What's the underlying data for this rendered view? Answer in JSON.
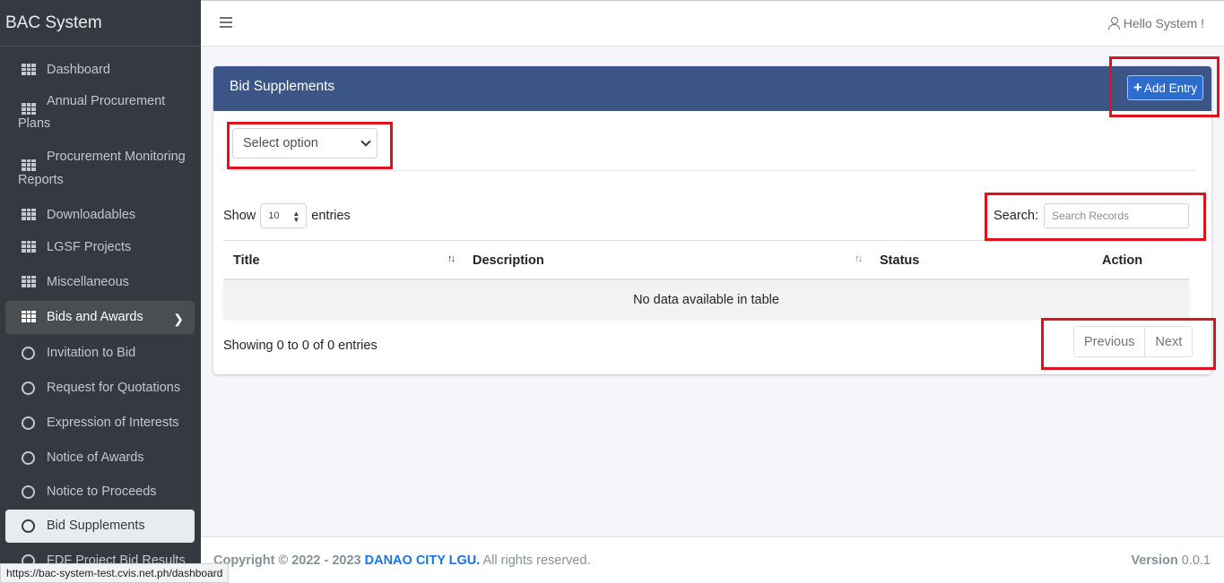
{
  "app": {
    "brand": "BAC System"
  },
  "sidebar": {
    "items": [
      {
        "label": "Dashboard",
        "icon": "grid-icon"
      },
      {
        "label": "Annual Procurement Plans",
        "icon": "grid-icon"
      },
      {
        "label": "Procurement Monitoring Reports",
        "icon": "grid-icon"
      },
      {
        "label": "Downloadables",
        "icon": "grid-icon"
      },
      {
        "label": "LGSF Projects",
        "icon": "grid-icon"
      },
      {
        "label": "Miscellaneous",
        "icon": "grid-icon"
      },
      {
        "label": "Bids and Awards",
        "icon": "grid-icon",
        "expanded": true
      },
      {
        "label": "Invitation to Bid",
        "icon": "circle-icon"
      },
      {
        "label": "Request for Quotations",
        "icon": "circle-icon"
      },
      {
        "label": "Expression of Interests",
        "icon": "circle-icon"
      },
      {
        "label": "Notice of Awards",
        "icon": "circle-icon"
      },
      {
        "label": "Notice to Proceeds",
        "icon": "circle-icon"
      },
      {
        "label": "Bid Supplements",
        "icon": "circle-icon",
        "active": true
      },
      {
        "label": "FDF Project Bid Results",
        "icon": "circle-icon"
      }
    ]
  },
  "header": {
    "greeting": "Hello System !"
  },
  "card": {
    "title": "Bid Supplements",
    "add_label": "Add Entry",
    "filter_select": "Select option",
    "show_label": "Show",
    "page_length": "10",
    "entries_label": "entries",
    "search_label": "Search:",
    "search_placeholder": "Search Records",
    "table": {
      "columns": [
        "Title",
        "Description",
        "Status",
        "Action"
      ],
      "empty_message": "No data available in table"
    },
    "info": "Showing 0 to 0 of 0 entries",
    "prev_label": "Previous",
    "next_label": "Next"
  },
  "footer": {
    "copyright_prefix": "Copyright © 2022 - 2023",
    "org": "DANAO CITY LGU.",
    "rights": "All rights reserved.",
    "version_label": "Version",
    "version_value": "0.0.1"
  },
  "statusbar": {
    "url": "https://bac-system-test.cvis.net.ph/dashboard"
  },
  "colors": {
    "sidebar": "#343a40",
    "card_header": "#3b5686",
    "accent": "#2c6ccf",
    "highlight": "#e0121d"
  }
}
